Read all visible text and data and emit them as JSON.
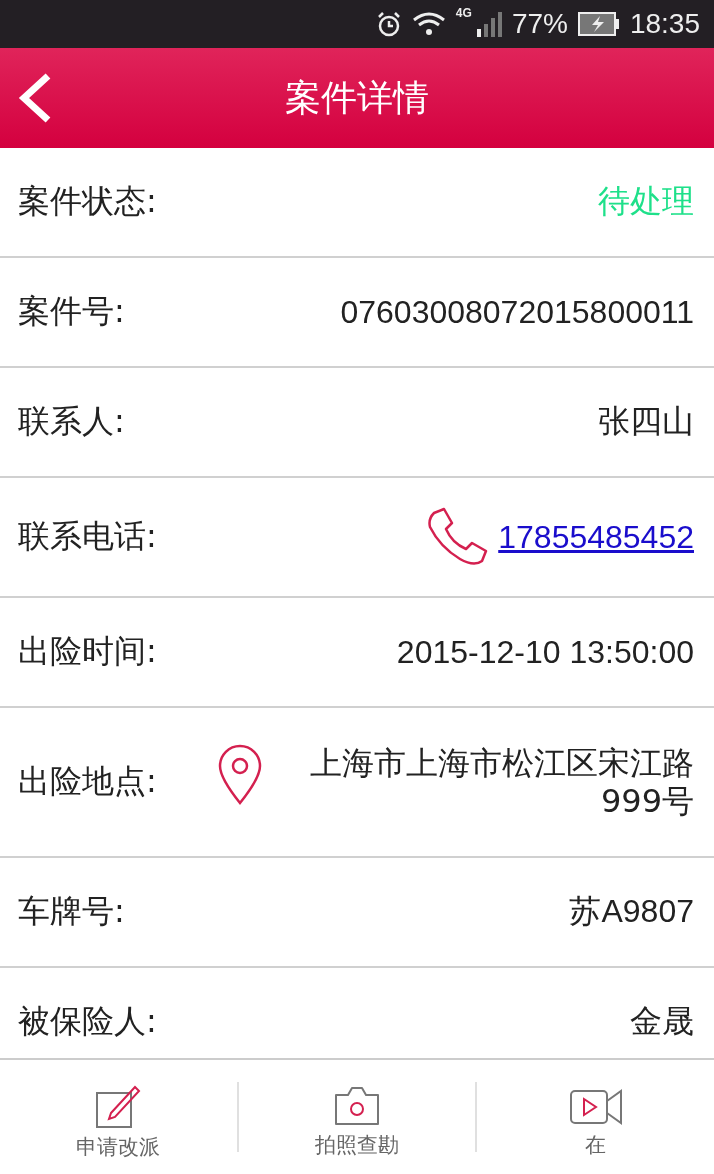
{
  "status_bar": {
    "network": "4G",
    "battery": "77%",
    "time": "18:35"
  },
  "header": {
    "title": "案件详情"
  },
  "rows": [
    {
      "kind": "status",
      "label": "案件状态:",
      "value": "待处理"
    },
    {
      "kind": "text",
      "label": "案件号:",
      "value": "07603008072015800011"
    },
    {
      "kind": "text",
      "label": "联系人:",
      "value": "张四山"
    },
    {
      "kind": "phone",
      "label": "联系电话:",
      "value": "17855485452"
    },
    {
      "kind": "text",
      "label": "出险时间:",
      "value": "2015-12-10 13:50:00"
    },
    {
      "kind": "address",
      "label": "出险地点:",
      "value": "上海市上海市松江区宋江路999号"
    },
    {
      "kind": "text",
      "label": "车牌号:",
      "value": "苏A9807"
    },
    {
      "kind": "text",
      "label": "被保险人:",
      "value": "金晟"
    }
  ],
  "tabs": [
    {
      "kind": "edit",
      "label": "申请改派"
    },
    {
      "kind": "camera",
      "label": "拍照查勘"
    },
    {
      "kind": "video",
      "label": "在"
    }
  ]
}
